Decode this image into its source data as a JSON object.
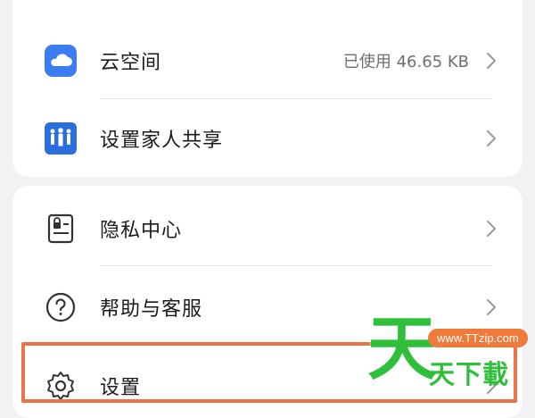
{
  "menu": {
    "cloud": {
      "label": "云空间",
      "value": "已使用 46.65 KB",
      "icon": "cloud-icon"
    },
    "family": {
      "label": "设置家人共享",
      "icon": "family-icon"
    },
    "privacy": {
      "label": "隐私中心",
      "icon": "privacy-icon"
    },
    "help": {
      "label": "帮助与客服",
      "icon": "help-icon"
    },
    "settings": {
      "label": "设置",
      "icon": "gear-icon"
    }
  },
  "watermark": {
    "mark": "天",
    "url": "www.TTzip.com",
    "text": "天下載"
  },
  "colors": {
    "highlight": "#e8744a",
    "watermark_green": "#2fbf3b",
    "cloud_blue": "#3b7cf0"
  }
}
